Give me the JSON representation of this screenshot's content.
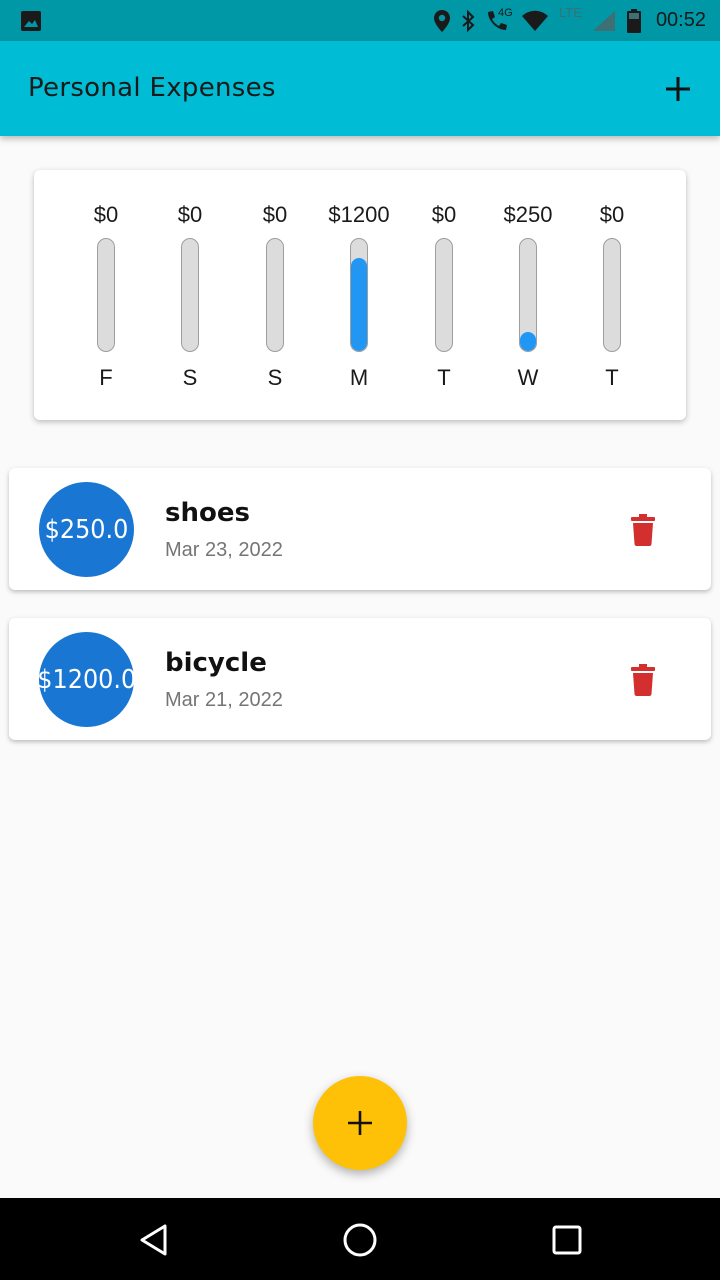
{
  "status_bar": {
    "time": "00:52",
    "network_label": "4G",
    "lte_label": "LTE",
    "icons": [
      "image-icon",
      "location-icon",
      "bluetooth-icon",
      "call-icon",
      "wifi-icon",
      "signal-icon",
      "battery-icon"
    ]
  },
  "app_bar": {
    "title": "Personal Expenses",
    "add_icon": "plus-icon"
  },
  "chart": {
    "bar_color": "#2196f3",
    "track_color": "#dcdcdc",
    "bars": [
      {
        "day": "F",
        "amount": "$0",
        "fraction": 0
      },
      {
        "day": "S",
        "amount": "$0",
        "fraction": 0
      },
      {
        "day": "S",
        "amount": "$0",
        "fraction": 0
      },
      {
        "day": "M",
        "amount": "$1200",
        "fraction": 0.83
      },
      {
        "day": "T",
        "amount": "$0",
        "fraction": 0
      },
      {
        "day": "W",
        "amount": "$250",
        "fraction": 0.17
      },
      {
        "day": "T",
        "amount": "$0",
        "fraction": 0
      }
    ]
  },
  "transactions": [
    {
      "amount": "$250.0",
      "title": "shoes",
      "date": "Mar 23, 2022"
    },
    {
      "amount": "$1200.0",
      "title": "bicycle",
      "date": "Mar 21, 2022"
    }
  ],
  "colors": {
    "app_bar": "#00bcd4",
    "status_bar": "#0097a7",
    "avatar": "#1976d2",
    "delete": "#d32f2f",
    "fab": "#ffc107"
  },
  "fab": {
    "icon": "plus-icon"
  },
  "nav_bar": {
    "icons": [
      "back-icon",
      "home-icon",
      "recents-icon"
    ]
  }
}
